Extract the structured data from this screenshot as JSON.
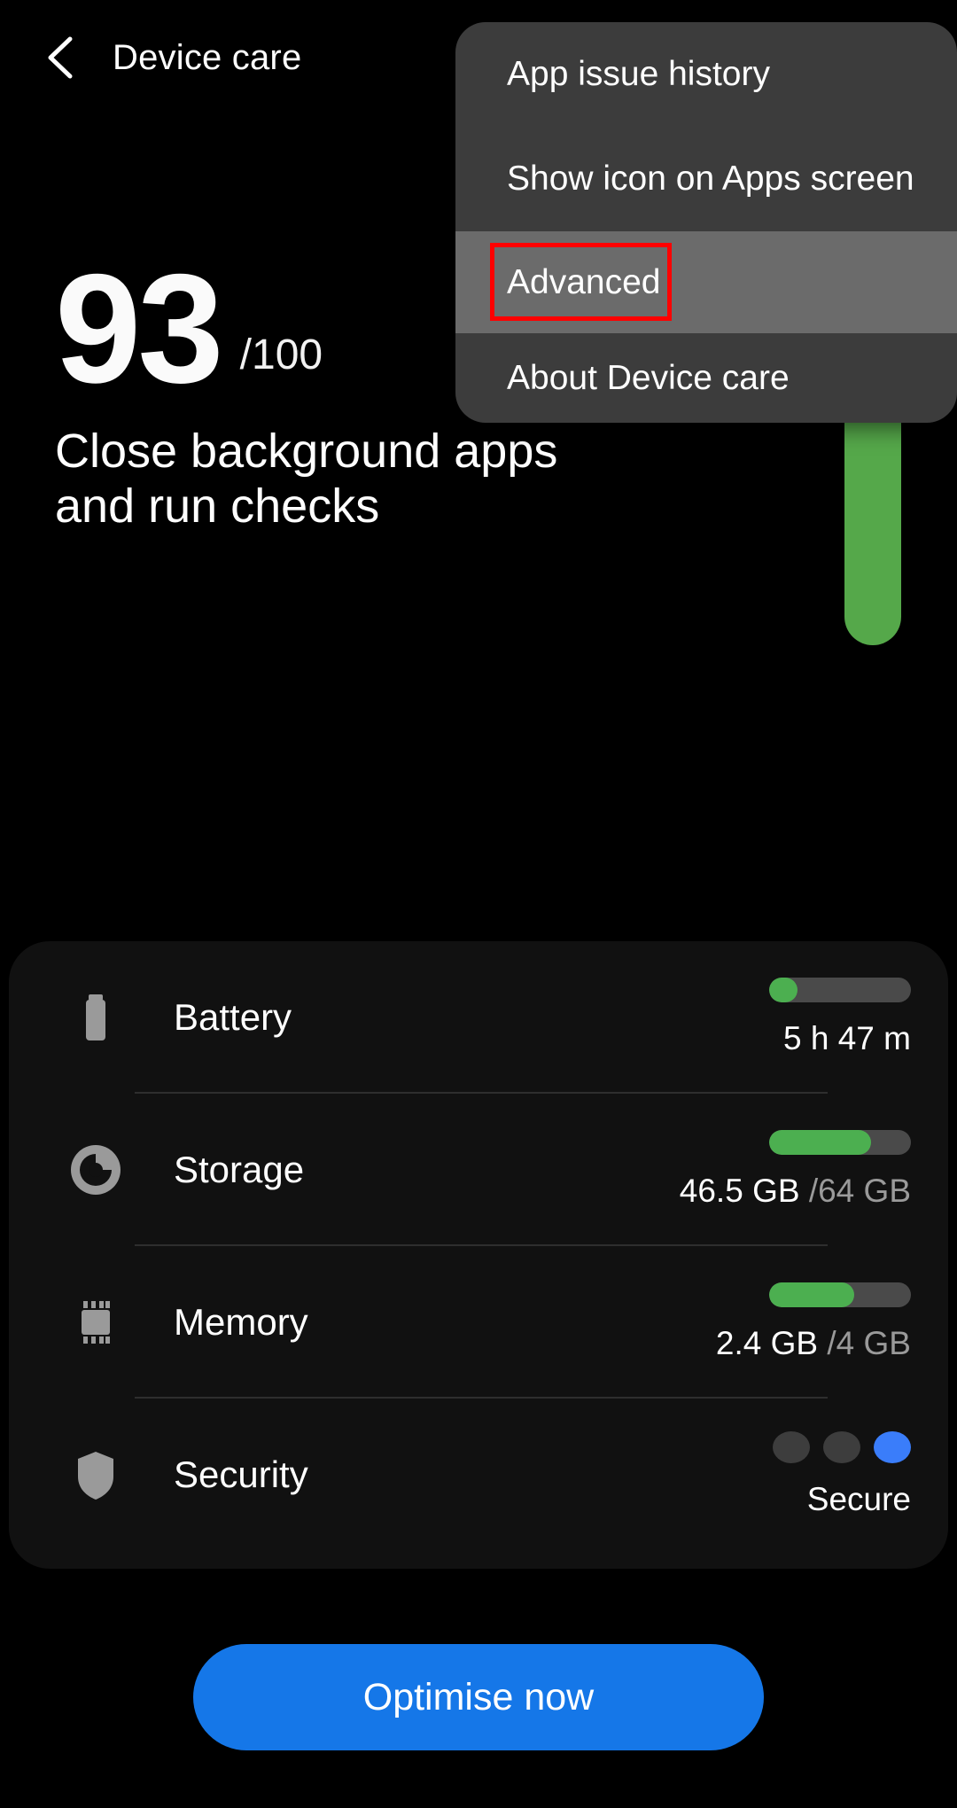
{
  "header": {
    "back_icon": "chevron-left-icon",
    "title": "Device care"
  },
  "score": {
    "value": "93",
    "total": "/100",
    "subtitle": "Close background apps and run checks",
    "bar_color": "#55a84a"
  },
  "menu": {
    "items": [
      {
        "label": "App issue history",
        "highlighted": false
      },
      {
        "label": "Show icon on Apps screen",
        "highlighted": false
      },
      {
        "label": "Advanced",
        "highlighted": true
      },
      {
        "label": "About Device care",
        "highlighted": false
      }
    ],
    "highlight_color": "#6b6b6b",
    "background_color": "#3c3c3c",
    "annotation_color": "#ff0000"
  },
  "card": {
    "rows": [
      {
        "icon": "battery-icon",
        "label": "Battery",
        "value_main": "5 h 47 m",
        "value_muted": "",
        "bar_percent": 20,
        "bar_color": "#4caf50"
      },
      {
        "icon": "storage-pie-icon",
        "label": "Storage",
        "value_main": "46.5 GB",
        "value_muted": " /64 GB",
        "bar_percent": 72,
        "bar_color": "#4caf50"
      },
      {
        "icon": "memory-chip-icon",
        "label": "Memory",
        "value_main": "2.4 GB",
        "value_muted": " /4 GB",
        "bar_percent": 60,
        "bar_color": "#4caf50"
      },
      {
        "icon": "shield-icon",
        "label": "Security",
        "value_main": "Secure",
        "value_muted": "",
        "dots": [
          "#3d3d3d",
          "#3d3d3d",
          "#3a7dfa"
        ]
      }
    ]
  },
  "footer": {
    "optimise_label": "Optimise now",
    "optimise_color": "#1577e8"
  }
}
